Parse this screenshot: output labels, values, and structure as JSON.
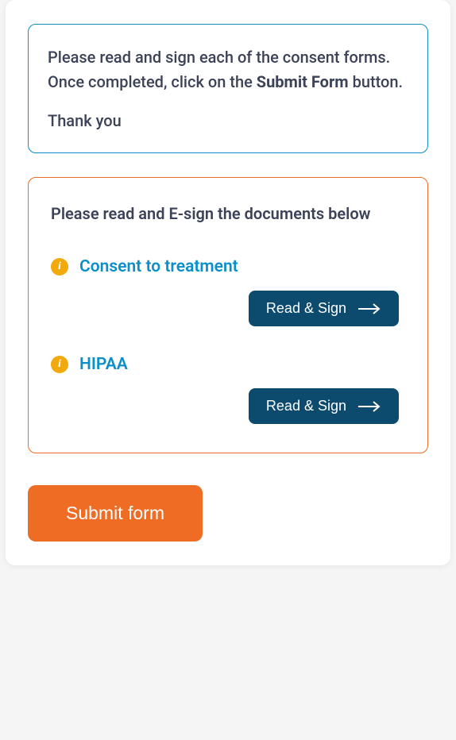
{
  "infoBox": {
    "line_before_bold": "Please read and sign each of the consent forms. Once completed, click on the ",
    "bold_text": "Submit Form",
    "line_after_bold": " button.",
    "thank_you": "Thank you"
  },
  "signBox": {
    "heading": "Please read and E-sign the documents below",
    "documents": [
      {
        "title": "Consent to treatment",
        "button_label": "Read & Sign"
      },
      {
        "title": "HIPAA",
        "button_label": "Read & Sign"
      }
    ]
  },
  "submit_label": "Submit form"
}
